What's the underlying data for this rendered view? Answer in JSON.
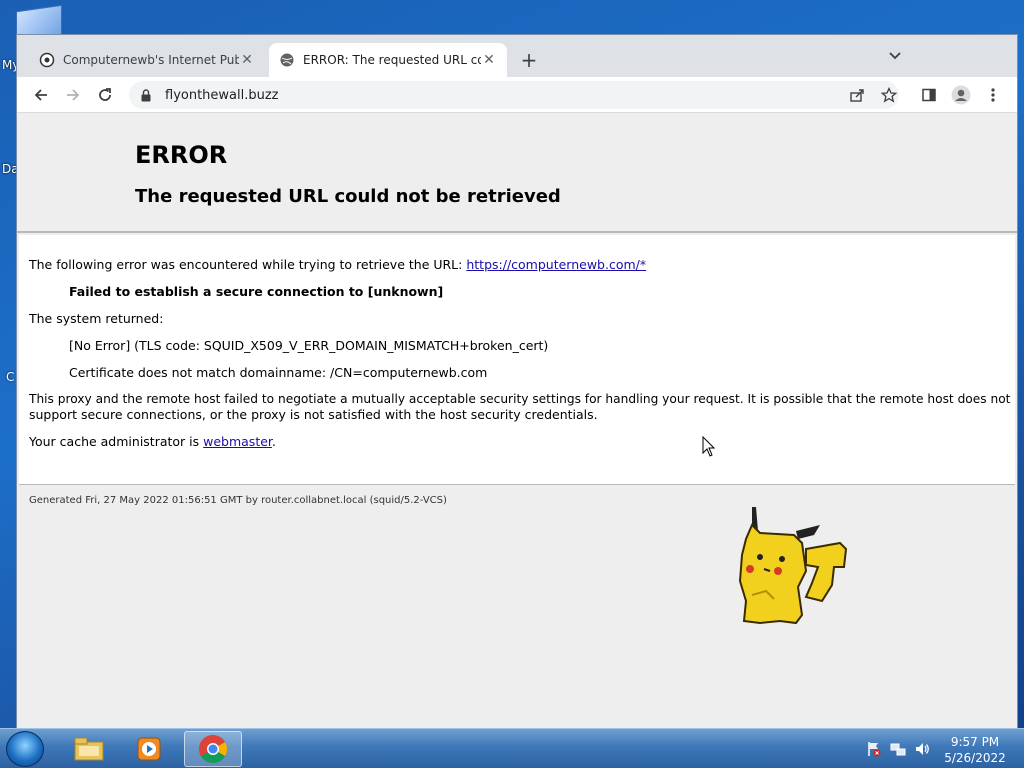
{
  "desktop": {
    "labels": [
      "My",
      "Da",
      "C"
    ]
  },
  "browser": {
    "tabs": [
      {
        "title": "Computernewb's Internet Pub Hu",
        "active": false
      },
      {
        "title": "ERROR: The requested URL could",
        "active": true
      }
    ],
    "new_tab_label": "+",
    "url": "flyonthewall.buzz"
  },
  "page": {
    "heading": "ERROR",
    "subheading": "The requested URL could not be retrieved",
    "intro_text": "The following error was encountered while trying to retrieve the URL: ",
    "intro_link": "https://computernewb.com/*",
    "error_message": "Failed to establish a secure connection to [unknown]",
    "system_returned": "The system returned:",
    "tls_code": "[No Error] (TLS code: SQUID_X509_V_ERR_DOMAIN_MISMATCH+broken_cert)",
    "cert_detail": "Certificate does not match domainname: /CN=computernewb.com",
    "explanation_line1": "This proxy and the remote host failed to negotiate a mutually acceptable security settings for handling your request. It is possible that the remote host does not",
    "explanation_line2": "support secure connections, or the proxy is not satisfied with the host security credentials.",
    "admin_text": "Your cache administrator is ",
    "admin_link": "webmaster",
    "admin_suffix": ".",
    "footer": "Generated Fri, 27 May 2022 01:56:51 GMT by router.collabnet.local (squid/5.2-VCS)"
  },
  "taskbar": {
    "time": "9:57 PM",
    "date": "5/26/2022"
  },
  "colors": {
    "link": "#1a0dab",
    "desktop": "#1c6fc9",
    "taskbar": "#3e78b8"
  }
}
